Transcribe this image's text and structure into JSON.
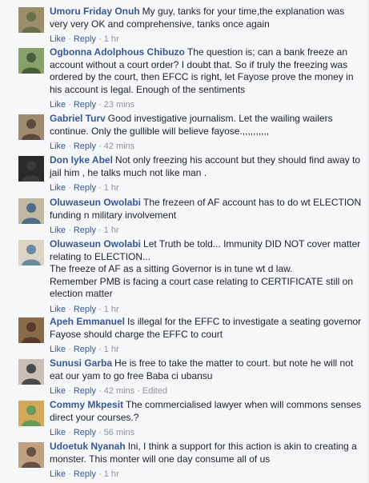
{
  "actions": {
    "like": "Like",
    "reply": "Reply",
    "separator": "·"
  },
  "comments": [
    {
      "name": "Umoru Friday Onuh",
      "text": "My guy, tanks for your time,the explanation was very very OK and comprehensive, tanks once again",
      "time": "1 hr",
      "edited": ""
    },
    {
      "name": "Ogbonna Adolphous Chibuzo",
      "text": "The question is; can a bank freeze an account without a court order? I doubt that. So if truly the freezing was ordered by the court, then EFCC is right, let Fayose prove the money in his account is legal. Enough of the sentiments",
      "time": "23 mins",
      "edited": ""
    },
    {
      "name": "Gabriel Turv",
      "text": "Good investigative journalism. Let the wailing wailers continue. Only the gullible will believe fayose.,,,,,,,,,,",
      "time": "42 mins",
      "edited": ""
    },
    {
      "name": "Don Iyke Abel",
      "text": "Not only freezing his account but they should find away to jail him , he talks much not like man .",
      "time": "1 hr",
      "edited": ""
    },
    {
      "name": "Oluwaseun Owolabi",
      "text": "The frezeen of AF account has to do wt ELECTION funding n military involvement",
      "time": "1 hr",
      "edited": ""
    },
    {
      "name": "Oluwaseun Owolabi",
      "text": "Let Truth be told... Immunity DID NOT cover matter relating to ELECTION...",
      "extra": [
        "The freeze of AF as a sitting Governor is in tune wt d law.",
        "Remember PMB is facing a court case relating to CERTIFICATE still on election matter"
      ],
      "time": "1 hr",
      "edited": ""
    },
    {
      "name": "Apeh Emmanuel",
      "text": "Is illegal for the EFFC to investigate a seating governor Fayose should charge the EFFC to court",
      "time": "1 hr",
      "edited": ""
    },
    {
      "name": "Sunusi Garba",
      "text": "He is free to take the matter to court. but note he will not eat our yam to go free Baba ci ubansu",
      "time": "42 mins",
      "edited": "Edited"
    },
    {
      "name": "Commy Mkpesit",
      "text": "The commercialised lawyer when will commons senses direct your courses.?",
      "time": "56 mins",
      "edited": ""
    },
    {
      "name": "Udoetuk Nyanah",
      "text": "Ini, I think a support for this action is akin to creating a monster. This monter will one day consume all of us",
      "time": "1 hr",
      "edited": ""
    }
  ],
  "avatar_colors": [
    [
      "#6b6f4a",
      "#9a8f6a"
    ],
    [
      "#4a5d3a",
      "#8aa06a"
    ],
    [
      "#5a4a3a",
      "#a08a70"
    ],
    [
      "#3a3a3a",
      "#2a2a2a"
    ],
    [
      "#4c6e8a",
      "#c0b8a0"
    ],
    [
      "#6a8aa0",
      "#dcd4c4"
    ],
    [
      "#5a3a2a",
      "#8a6a4a"
    ],
    [
      "#4a4a4a",
      "#c8c0b8"
    ],
    [
      "#6a9a5a",
      "#d4a85a"
    ],
    [
      "#6a5040",
      "#c0a080"
    ]
  ]
}
